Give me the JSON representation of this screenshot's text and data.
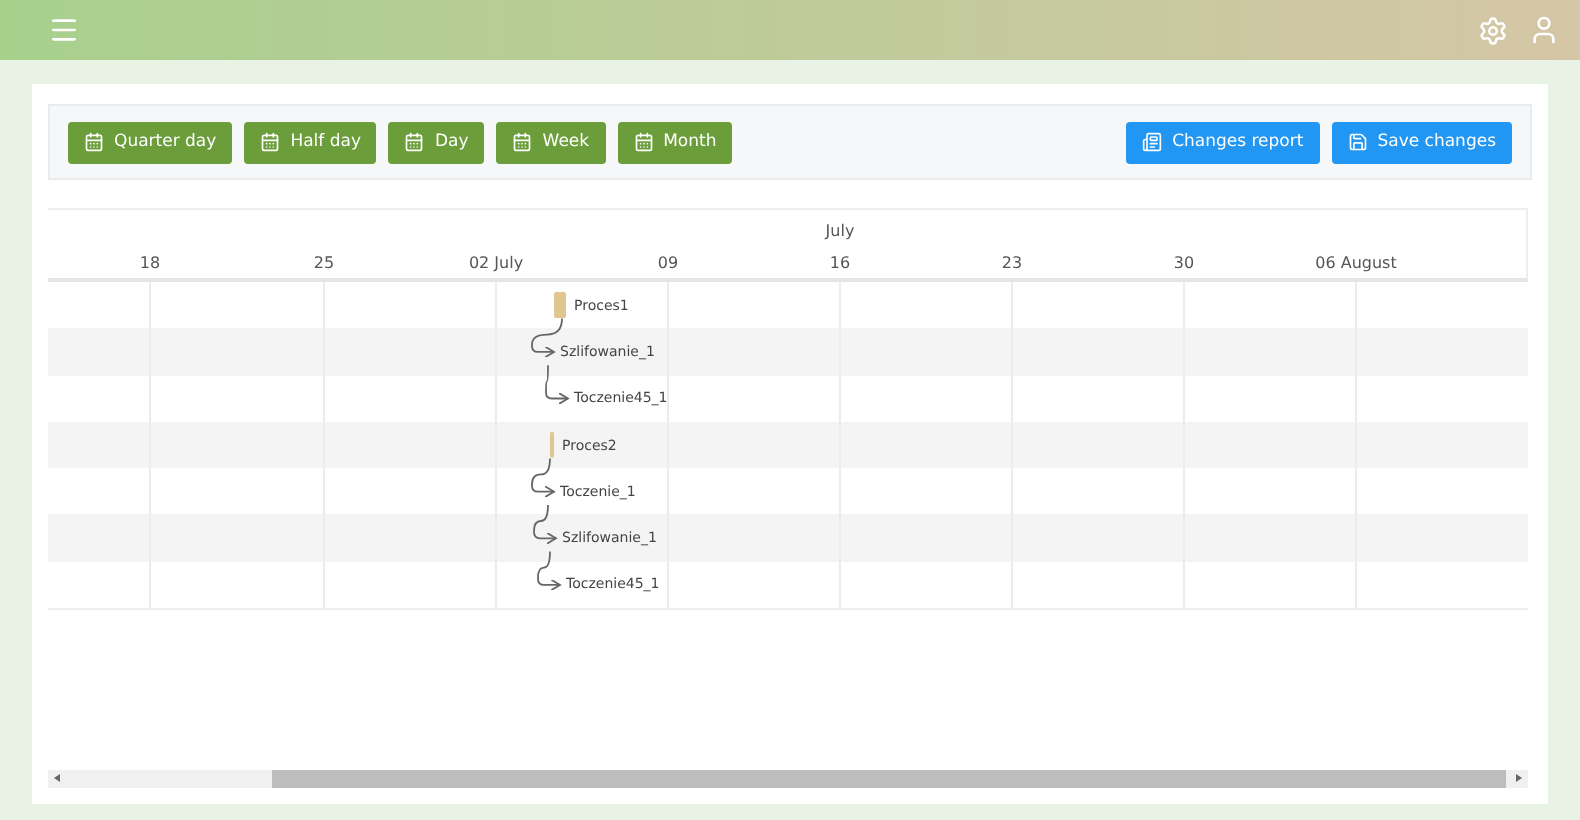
{
  "toolbar": {
    "scale_buttons": [
      "Quarter day",
      "Half day",
      "Day",
      "Week",
      "Month"
    ],
    "action_buttons": [
      "Changes report",
      "Save changes"
    ]
  },
  "timeline": {
    "month": "July",
    "ticks": [
      "18",
      "25",
      "02 July",
      "09",
      "16",
      "23",
      "30",
      "06 August"
    ]
  },
  "tasks": [
    {
      "name": "Proces1",
      "kind": "summary"
    },
    {
      "name": "Szlifowanie_1",
      "kind": "task"
    },
    {
      "name": "Toczenie45_1",
      "kind": "task"
    },
    {
      "name": "Proces2",
      "kind": "summary"
    },
    {
      "name": "Toczenie_1",
      "kind": "task"
    },
    {
      "name": "Szlifowanie_1",
      "kind": "task"
    },
    {
      "name": "Toczenie45_1",
      "kind": "task"
    }
  ]
}
